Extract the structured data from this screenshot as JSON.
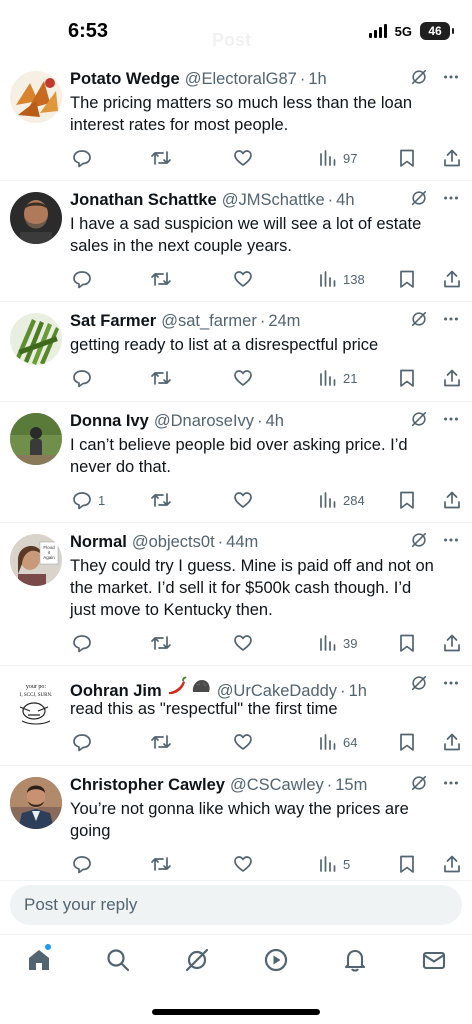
{
  "status_bar": {
    "time": "6:53",
    "network": "5G",
    "battery": "46",
    "header_title": "Post"
  },
  "posts": [
    {
      "name": "Potato Wedge",
      "handle": "@ElectoralG87",
      "time": "1h",
      "text": "The pricing matters so much less than the loan interest rates for most people.",
      "replies": "",
      "views": "97",
      "avatar": "potato-wedges"
    },
    {
      "name": "Jonathan Schattke",
      "handle": "@JMSchattke",
      "time": "4h",
      "text": "I have a sad suspicion we will see a lot of estate sales in the next couple years.",
      "replies": "",
      "views": "138",
      "avatar": "bearded-man"
    },
    {
      "name": "Sat Farmer",
      "handle": "@sat_farmer",
      "time": "24m",
      "text": "getting ready to list at a disrespectful price",
      "replies": "",
      "views": "21",
      "avatar": "asparagus"
    },
    {
      "name": "Donna Ivy",
      "handle": "@DnaroseIvy",
      "time": "4h",
      "text": "I can’t believe people bid over asking price.  I’d never do that.",
      "replies": "1",
      "views": "284",
      "avatar": "person-outdoors"
    },
    {
      "name": "Normal",
      "handle": "@objects0t",
      "time": "44m",
      "text": "They could try I guess. Mine is paid off and not on the market. I’d sell it for $500k cash though. I’d just move to Kentucky then.",
      "replies": "",
      "views": "39",
      "avatar": "woman-with-sign",
      "avatar_text": "Flood it Again"
    },
    {
      "name": "Oohran Jim",
      "handle": "@UrCakeDaddy",
      "time": "1h",
      "text": "read this as \"respectful\" the first time",
      "replies": "",
      "views": "64",
      "avatar": "cartoon-meme",
      "emoji": [
        "chili-pepper-emoji",
        "rock-emoji"
      ],
      "avatar_text": "your po: I, SCCJ, SURN."
    },
    {
      "name": "Christopher Cawley",
      "handle": "@CSCawley",
      "time": "15m",
      "text": "You’re not gonna like which way the prices are going",
      "replies": "",
      "views": "5",
      "avatar": "man-in-suit"
    }
  ],
  "reply_bar": {
    "placeholder": "Post your reply"
  },
  "bottom_nav": [
    "home-icon",
    "search-icon",
    "grok-icon",
    "video-icon",
    "notifications-icon",
    "messages-icon"
  ],
  "colors": {
    "text": "#0f1419",
    "secondary": "#536471",
    "accent": "#1d9bf0",
    "divider": "#eff3f4"
  }
}
